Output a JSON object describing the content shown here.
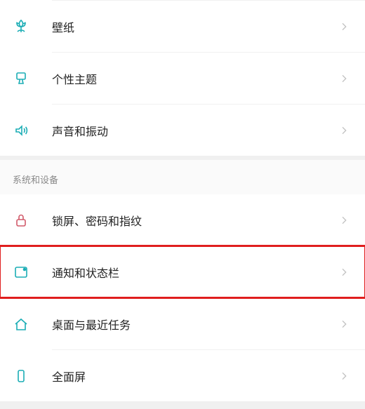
{
  "colors": {
    "accent": "#1badb5",
    "red": "#d15a6a",
    "highlight_box": "#e01e1e",
    "chevron": "#c2c2c2",
    "text": "#222",
    "muted": "#8a8a8a"
  },
  "groups": [
    {
      "header": null,
      "items": [
        {
          "icon": "tulip-icon",
          "label": "壁纸",
          "highlighted": false
        },
        {
          "icon": "brush-icon",
          "label": "个性主题",
          "highlighted": false
        },
        {
          "icon": "sound-icon",
          "label": "声音和振动",
          "highlighted": false
        }
      ]
    },
    {
      "header": "系统和设备",
      "items": [
        {
          "icon": "lock-icon",
          "label": "锁屏、密码和指纹",
          "highlighted": false
        },
        {
          "icon": "notification-icon",
          "label": "通知和状态栏",
          "highlighted": true
        },
        {
          "icon": "home-icon",
          "label": "桌面与最近任务",
          "highlighted": false
        },
        {
          "icon": "fullscreen-icon",
          "label": "全面屏",
          "highlighted": false
        }
      ]
    }
  ]
}
